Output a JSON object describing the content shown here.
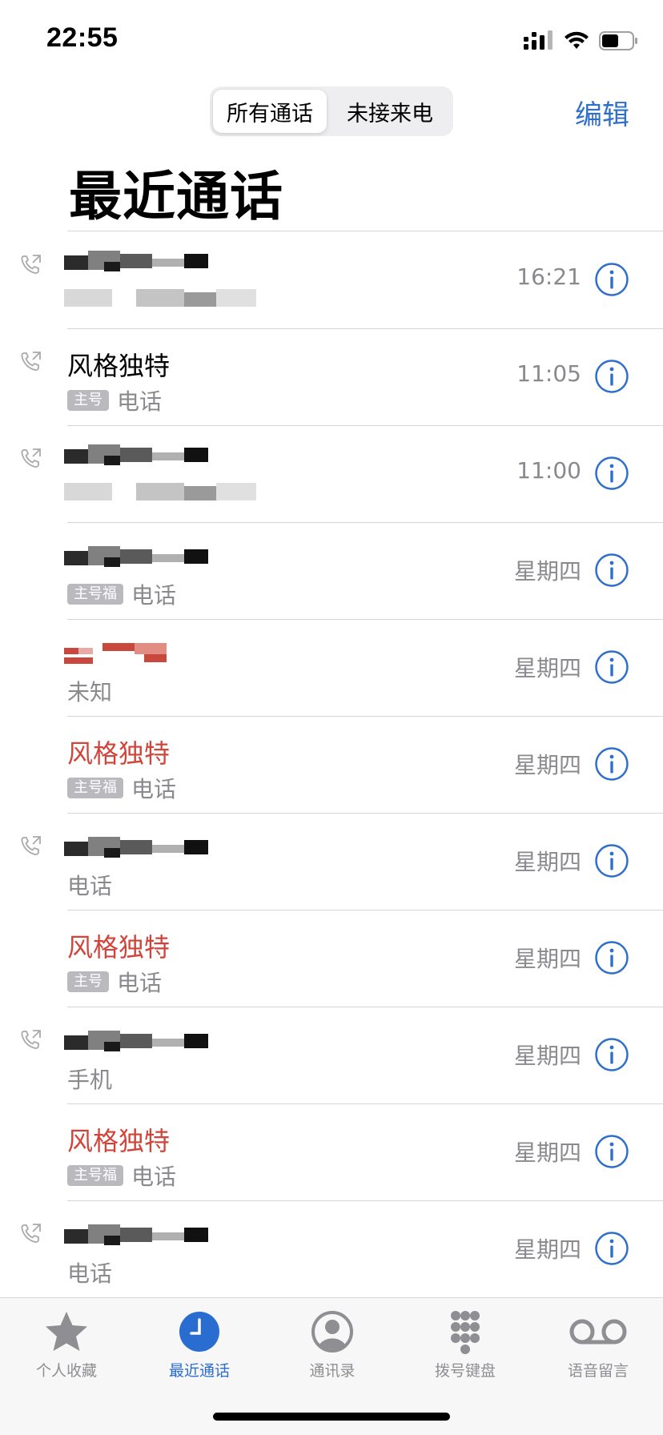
{
  "status_bar": {
    "time": "22:55"
  },
  "nav": {
    "segments": [
      "所有通话",
      "未接来电"
    ],
    "selected_segment": "所有通话",
    "edit_label": "编辑",
    "title": "最近通话"
  },
  "calls": [
    {
      "name": "",
      "name_redacted": true,
      "sub": "",
      "sub_redacted": true,
      "badge": "",
      "time": "16:21",
      "missed": false,
      "outgoing": true
    },
    {
      "name": "风格独特",
      "name_redacted": false,
      "sub": "电话",
      "badge": "主号",
      "time": "11:05",
      "missed": false,
      "outgoing": true
    },
    {
      "name": "",
      "name_redacted": true,
      "sub": "",
      "sub_redacted": true,
      "badge": "",
      "time": "11:00",
      "missed": false,
      "outgoing": true
    },
    {
      "name": "",
      "name_redacted": true,
      "sub": "电话",
      "badge": "主号福",
      "time": "星期四",
      "missed": false,
      "outgoing": false
    },
    {
      "name": "",
      "name_redacted": true,
      "sub": "未知",
      "badge": "",
      "time": "星期四",
      "missed": true,
      "outgoing": false
    },
    {
      "name": "风格独特",
      "name_redacted": false,
      "sub": "电话",
      "badge": "主号福",
      "time": "星期四",
      "missed": true,
      "outgoing": false
    },
    {
      "name": "",
      "name_redacted": true,
      "sub": "电话",
      "badge": "",
      "time": "星期四",
      "missed": false,
      "outgoing": true
    },
    {
      "name": "风格独特",
      "name_redacted": false,
      "sub": "电话",
      "badge": "主号",
      "time": "星期四",
      "missed": true,
      "outgoing": false
    },
    {
      "name": "",
      "name_redacted": true,
      "sub": "手机",
      "badge": "",
      "time": "星期四",
      "missed": false,
      "outgoing": true
    },
    {
      "name": "风格独特",
      "name_redacted": false,
      "sub": "电话",
      "badge": "主号福",
      "time": "星期四",
      "missed": true,
      "outgoing": false
    },
    {
      "name": "",
      "name_redacted": true,
      "sub": "电话",
      "badge": "",
      "time": "星期四",
      "missed": false,
      "outgoing": true
    }
  ],
  "tab_bar": {
    "items": [
      {
        "label": "个人收藏",
        "icon": "star-icon",
        "active": false
      },
      {
        "label": "最近通话",
        "icon": "clock-icon",
        "active": true
      },
      {
        "label": "通讯录",
        "icon": "person-circle-icon",
        "active": false
      },
      {
        "label": "拨号键盘",
        "icon": "keypad-icon",
        "active": false
      },
      {
        "label": "语音留言",
        "icon": "voicemail-icon",
        "active": false
      }
    ]
  },
  "colors": {
    "accent": "#2f6fca",
    "missed": "#d2443a",
    "secondary_text": "#8a8a8e",
    "badge": "#b9b9be",
    "tab_active": "#2a6dd0",
    "tab_inactive": "#8e8e93"
  }
}
